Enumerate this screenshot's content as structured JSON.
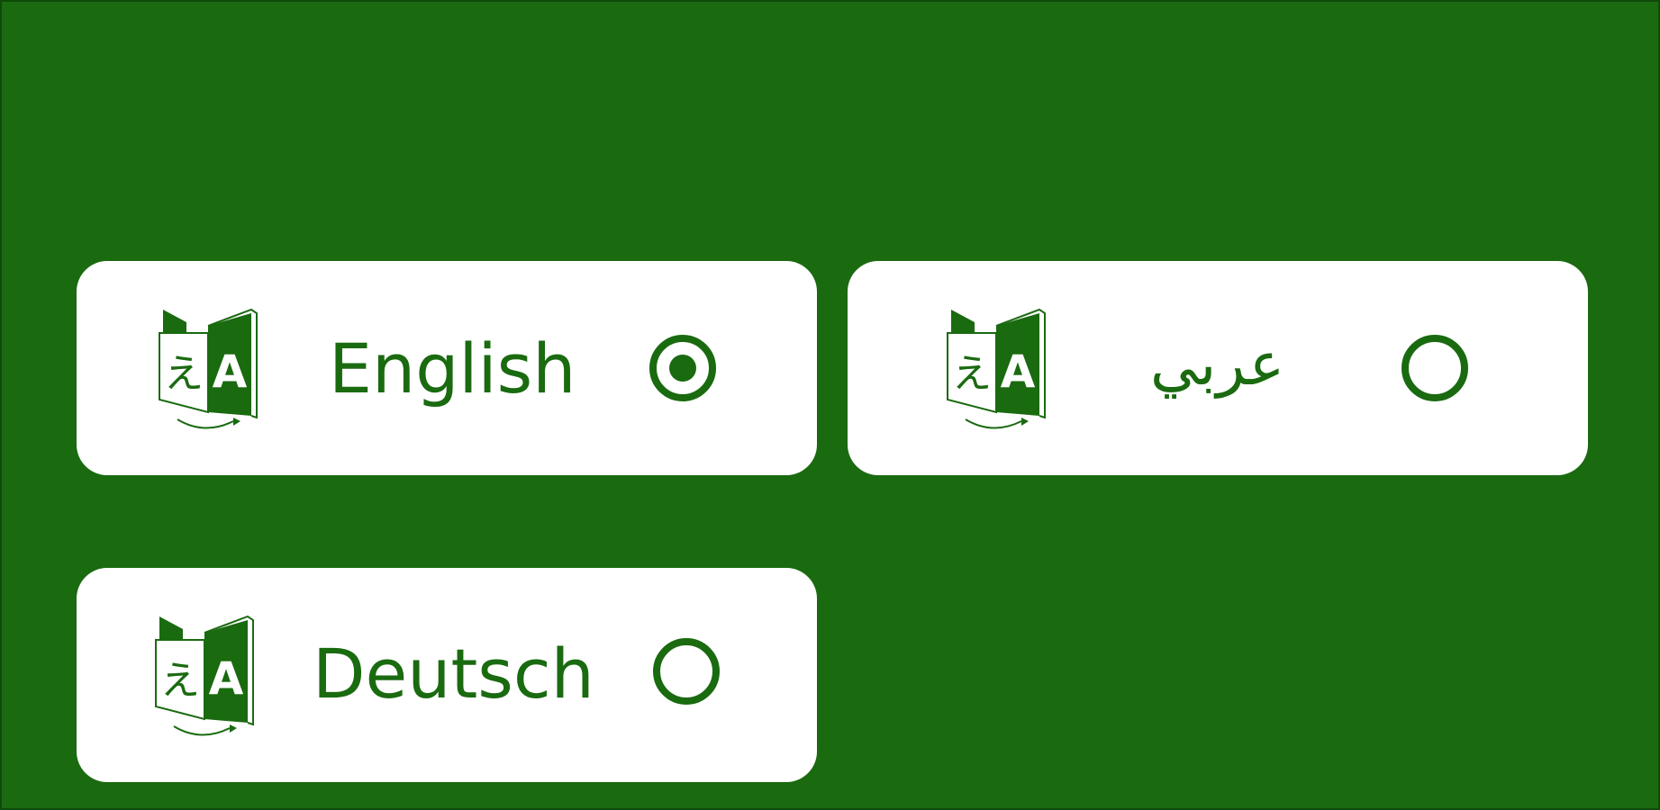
{
  "theme": {
    "background": "#1a6a10",
    "card_background": "#ffffff",
    "accent": "#1a6a10"
  },
  "languages": [
    {
      "label": "English",
      "icon": "translate-icon",
      "selected": true
    },
    {
      "label": "عربي",
      "icon": "translate-icon",
      "selected": false
    },
    {
      "label": "Deutsch",
      "icon": "translate-icon",
      "selected": false
    }
  ],
  "icon_glyphs": {
    "source": "え",
    "target": "A"
  }
}
